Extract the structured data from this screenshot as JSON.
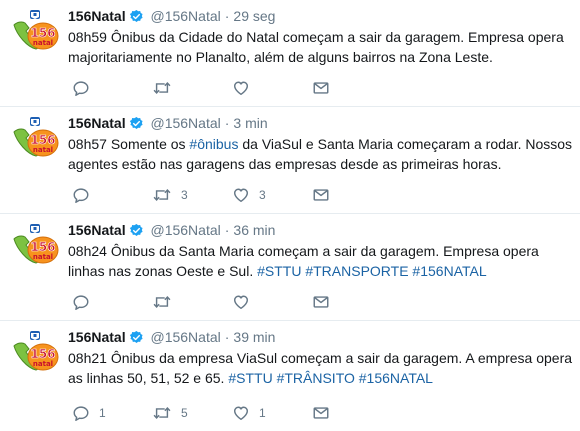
{
  "colors": {
    "hashtag": "#1b63a4",
    "verified": "#1da1f2",
    "muted": "#657786"
  },
  "tweets": [
    {
      "name": "156Natal",
      "handle": "@156Natal",
      "sep": "·",
      "time": "29 seg",
      "text_before": "08h59 Ônibus da Cidade do Natal começam a sair da garagem. Empresa opera majoritariamente no Planalto, além de alguns bairros na Zona Leste.",
      "hashtags": "",
      "reply_count": "",
      "retweet_count": "",
      "like_count": ""
    },
    {
      "name": "156Natal",
      "handle": "@156Natal",
      "sep": "·",
      "time": "3 min",
      "text_before": "08h57 Somente os ",
      "inline_tag": "#ônibus",
      "text_after": " da ViaSul e Santa Maria começaram a rodar. Nossos agentes estão nas garagens das empresas desde as primeiras horas.",
      "reply_count": "",
      "retweet_count": "3",
      "like_count": "3"
    },
    {
      "name": "156Natal",
      "handle": "@156Natal",
      "sep": "·",
      "time": "36 min",
      "text_before": "08h24 Ônibus da Santa Maria começam a sair da garagem. Empresa opera linhas nas zonas Oeste e Sul. ",
      "hashtags": "#STTU #TRANSPORTE #156NATAL",
      "reply_count": "",
      "retweet_count": "",
      "like_count": ""
    },
    {
      "name": "156Natal",
      "handle": "@156Natal",
      "sep": "·",
      "time": "39 min",
      "text_before": "08h21 Ônibus da empresa ViaSul começam a sair da garagem. A empresa opera as linhas 50, 51, 52 e 65. ",
      "hashtags": "#STTU #TRÂNSITO #156NATAL",
      "reply_count": "1",
      "retweet_count": "5",
      "like_count": "1"
    }
  ],
  "icons": {
    "avatar": "156-natal-logo",
    "verified": "verified-badge-icon",
    "reply": "reply-icon",
    "retweet": "retweet-icon",
    "like": "heart-icon",
    "dm": "envelope-icon"
  }
}
